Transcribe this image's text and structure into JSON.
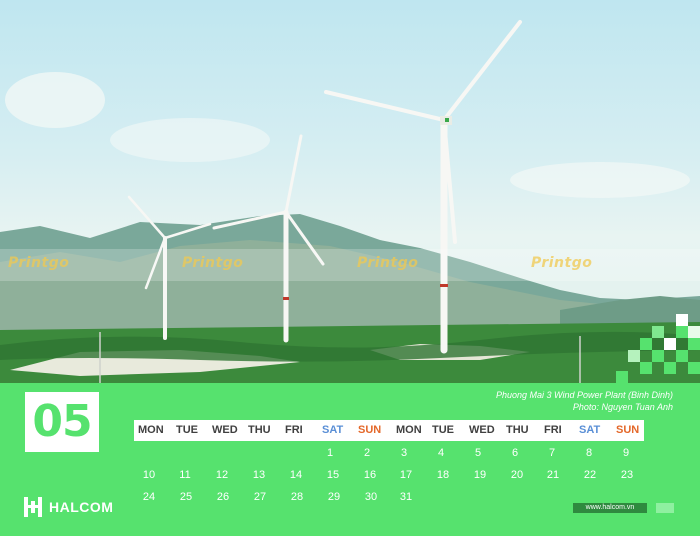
{
  "watermark": "Printgo",
  "month": "05",
  "caption": {
    "line1": "Phuong Mai 3 Wind Power Plant (Binh Dinh)",
    "line2": "Photo: Nguyen Tuan Anh"
  },
  "weekdays": [
    "MON",
    "TUE",
    "WED",
    "THU",
    "FRI",
    "SAT",
    "SUN",
    "MON",
    "TUE",
    "WED",
    "THU",
    "FRI",
    "SAT",
    "SUN"
  ],
  "dates": {
    "row1": [
      "1",
      "2",
      "3",
      "4",
      "5",
      "6",
      "7",
      "8",
      "9"
    ],
    "row2": [
      "10",
      "11",
      "12",
      "13",
      "14",
      "15",
      "16",
      "17",
      "18",
      "19",
      "20",
      "21",
      "22",
      "23"
    ],
    "row3": [
      "24",
      "25",
      "26",
      "27",
      "28",
      "29",
      "30",
      "31"
    ]
  },
  "brand": "HALCOM",
  "website": "www.halcom.vn",
  "colors": {
    "brand_green": "#56e26e",
    "sat": "#5a8fd6",
    "sun": "#e4682a"
  }
}
